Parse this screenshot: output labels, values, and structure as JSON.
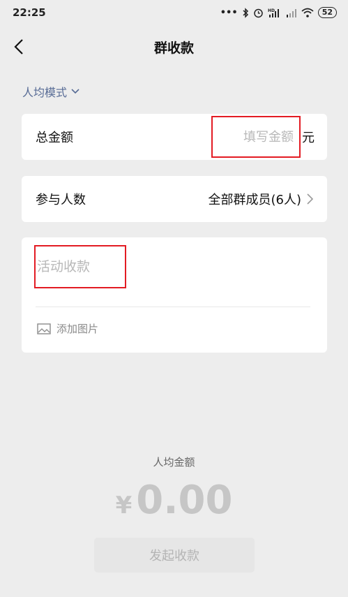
{
  "status_bar": {
    "time": "22:25",
    "icons": [
      "more-icon",
      "bluetooth-icon",
      "alarm-icon",
      "hd-signal-icon",
      "signal-icon",
      "wifi-icon"
    ],
    "battery": "52"
  },
  "nav": {
    "back_icon": "chevron-left-icon",
    "title": "群收款"
  },
  "mode": {
    "label": "人均模式",
    "icon": "chevron-down-icon",
    "color": "#576b95"
  },
  "total": {
    "label": "总金额",
    "placeholder": "填写金额",
    "unit": "元"
  },
  "participants": {
    "label": "参与人数",
    "value": "全部群成员(6人)",
    "icon": "chevron-right-icon"
  },
  "note": {
    "placeholder": "活动收款",
    "add_image_label": "添加图片",
    "add_image_icon": "image-icon"
  },
  "summary": {
    "label": "人均金额",
    "currency": "¥",
    "value": "0.00"
  },
  "submit": {
    "label": "发起收款"
  },
  "colors": {
    "highlight_border": "#e31b23",
    "background": "#ededed"
  }
}
